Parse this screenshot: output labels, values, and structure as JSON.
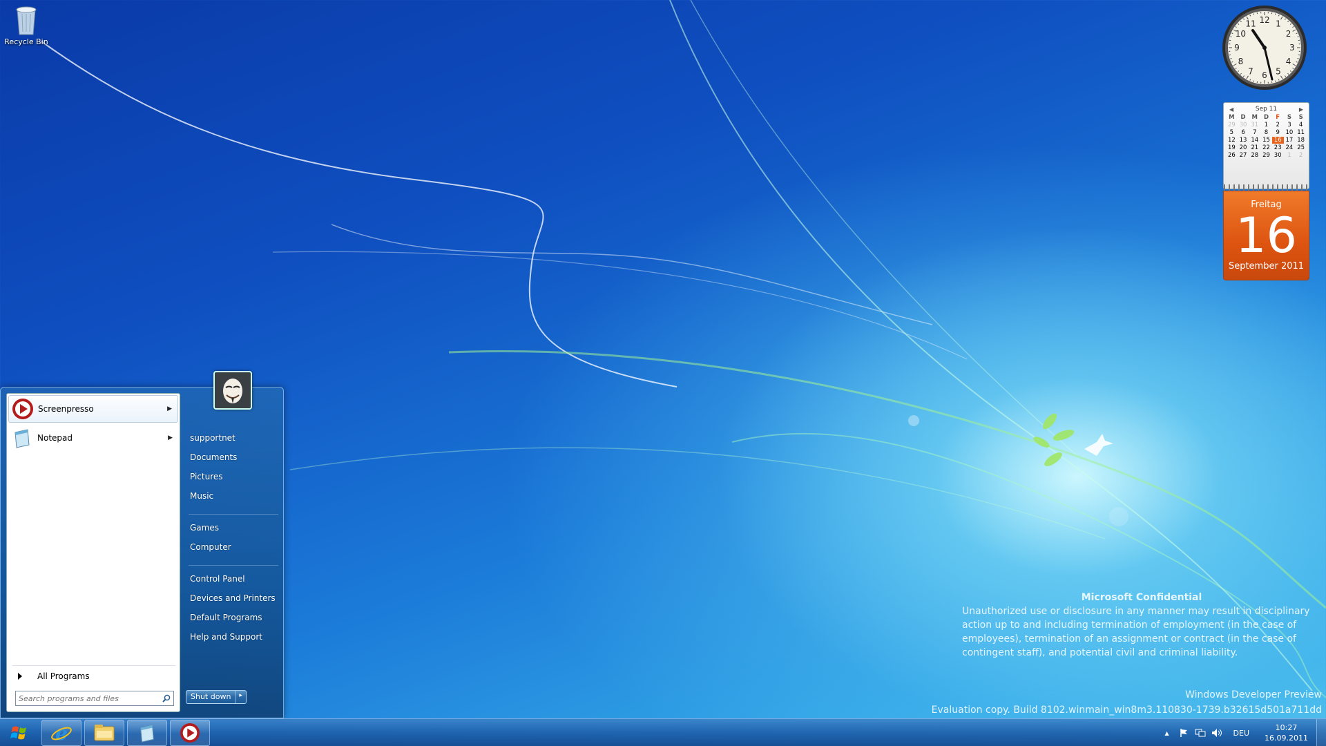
{
  "desktop": {
    "icons": [
      {
        "label": "Recycle Bin",
        "icon": "recycle-bin-icon"
      }
    ]
  },
  "gadgets": {
    "clock": {
      "hour_labels": [
        "12",
        "1",
        "2",
        "3",
        "4",
        "5",
        "6",
        "7",
        "8",
        "9",
        "10",
        "11"
      ],
      "time": "10:27"
    },
    "calendar": {
      "month_label": "Sep 11",
      "day_headers": [
        "M",
        "D",
        "M",
        "D",
        "F",
        "S",
        "S"
      ],
      "weeks": [
        [
          "29",
          "30",
          "31",
          "1",
          "2",
          "3",
          "4"
        ],
        [
          "5",
          "6",
          "7",
          "8",
          "9",
          "10",
          "11"
        ],
        [
          "12",
          "13",
          "14",
          "15",
          "16",
          "17",
          "18"
        ],
        [
          "19",
          "20",
          "21",
          "22",
          "23",
          "24",
          "25"
        ],
        [
          "26",
          "27",
          "28",
          "29",
          "30",
          "1",
          "2"
        ]
      ],
      "today": "16",
      "weekday": "Freitag",
      "day_number": "16",
      "month_year": "September 2011",
      "accent_color": "#e0541a"
    }
  },
  "watermark": {
    "title": "Microsoft Confidential",
    "body": "Unauthorized use or disclosure in any manner may result in disciplinary action up to and including termination of employment (in the case of employees), termination of an assignment or contract (in the case of contingent staff), and potential civil and criminal liability.",
    "product": "Windows Developer Preview",
    "build": "Evaluation copy. Build 8102.winmain_win8m3.110830-1739.b32615d501a711dd"
  },
  "start_menu": {
    "programs": [
      {
        "label": "Screenpresso",
        "icon": "screenpresso-icon"
      },
      {
        "label": "Notepad",
        "icon": "notepad-icon"
      }
    ],
    "all_programs_label": "All Programs",
    "search_placeholder": "Search programs and files",
    "places": [
      {
        "label": "supportnet"
      },
      {
        "label": "Documents"
      },
      {
        "label": "Pictures"
      },
      {
        "label": "Music"
      },
      {
        "label": "Games"
      },
      {
        "label": "Computer"
      },
      {
        "label": "Control Panel"
      },
      {
        "label": "Devices and Printers"
      },
      {
        "label": "Default Programs"
      },
      {
        "label": "Help and Support"
      }
    ],
    "shutdown_label": "Shut down",
    "shutdown_arrow": "▸"
  },
  "taskbar": {
    "pinned": [
      {
        "name": "internet-explorer-icon"
      },
      {
        "name": "windows-explorer-icon"
      },
      {
        "name": "notepad-icon"
      },
      {
        "name": "screenpresso-icon"
      }
    ],
    "tray": {
      "expand_arrow": "▲",
      "language": "DEU",
      "time": "10:27",
      "date": "16.09.2011"
    }
  }
}
